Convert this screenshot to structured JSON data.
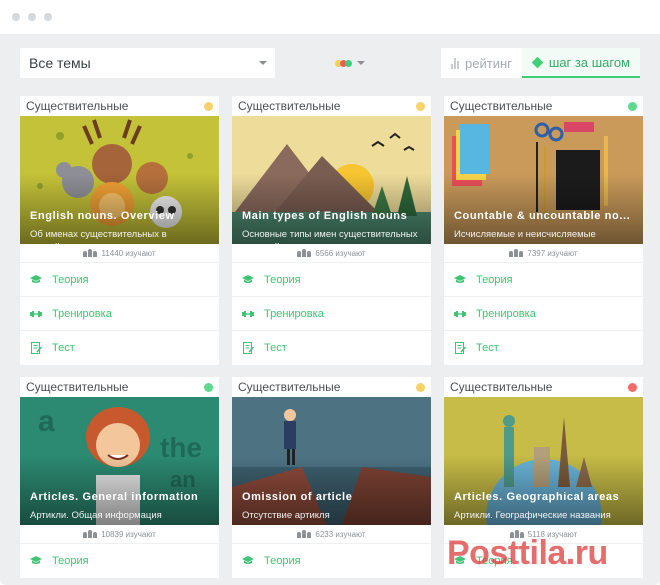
{
  "toolbar": {
    "theme_select": "Все темы",
    "level_colors": [
      "#f2d450",
      "#f05a5a",
      "#3fcf76"
    ],
    "views": [
      {
        "label": "рейтинг",
        "icon": "bar-chart-icon",
        "active": false
      },
      {
        "label": "шаг за шагом",
        "icon": "cube-icon",
        "active": true
      }
    ]
  },
  "action_labels": {
    "theory": "Теория",
    "training": "Тренировка",
    "test": "Тест"
  },
  "status_colors": {
    "yellow": "#f7d26a",
    "green": "#5fd98e",
    "red": "#f26a6a"
  },
  "cards": [
    {
      "category": "Существительные",
      "status": "yellow",
      "title": "English nouns. Overview",
      "subtitle": "Об именах существительных в английском",
      "learners": "11440 изучают"
    },
    {
      "category": "Существительные",
      "status": "yellow",
      "title": "Main types of English nouns",
      "subtitle": "Основные типы имен существительных в английском",
      "learners": "6566 изучают"
    },
    {
      "category": "Существительные",
      "status": "green",
      "title": "Countable & uncountable no...",
      "subtitle": "Исчисляемые и неисчисляемые существительные",
      "learners": "7397 изучают"
    },
    {
      "category": "Существительные",
      "status": "green",
      "title": "Articles. General information",
      "subtitle": "Артикли. Общая информация",
      "learners": "10839 изучают"
    },
    {
      "category": "Существительные",
      "status": "yellow",
      "title": "Omission of article",
      "subtitle": "Отсутствие артикля",
      "learners": "6233 изучают"
    },
    {
      "category": "Существительные",
      "status": "red",
      "title": "Articles. Geographical areas",
      "subtitle": "Артикли. Географические названия",
      "learners": "5118 изучают"
    }
  ],
  "watermark": "Posttila.ru"
}
